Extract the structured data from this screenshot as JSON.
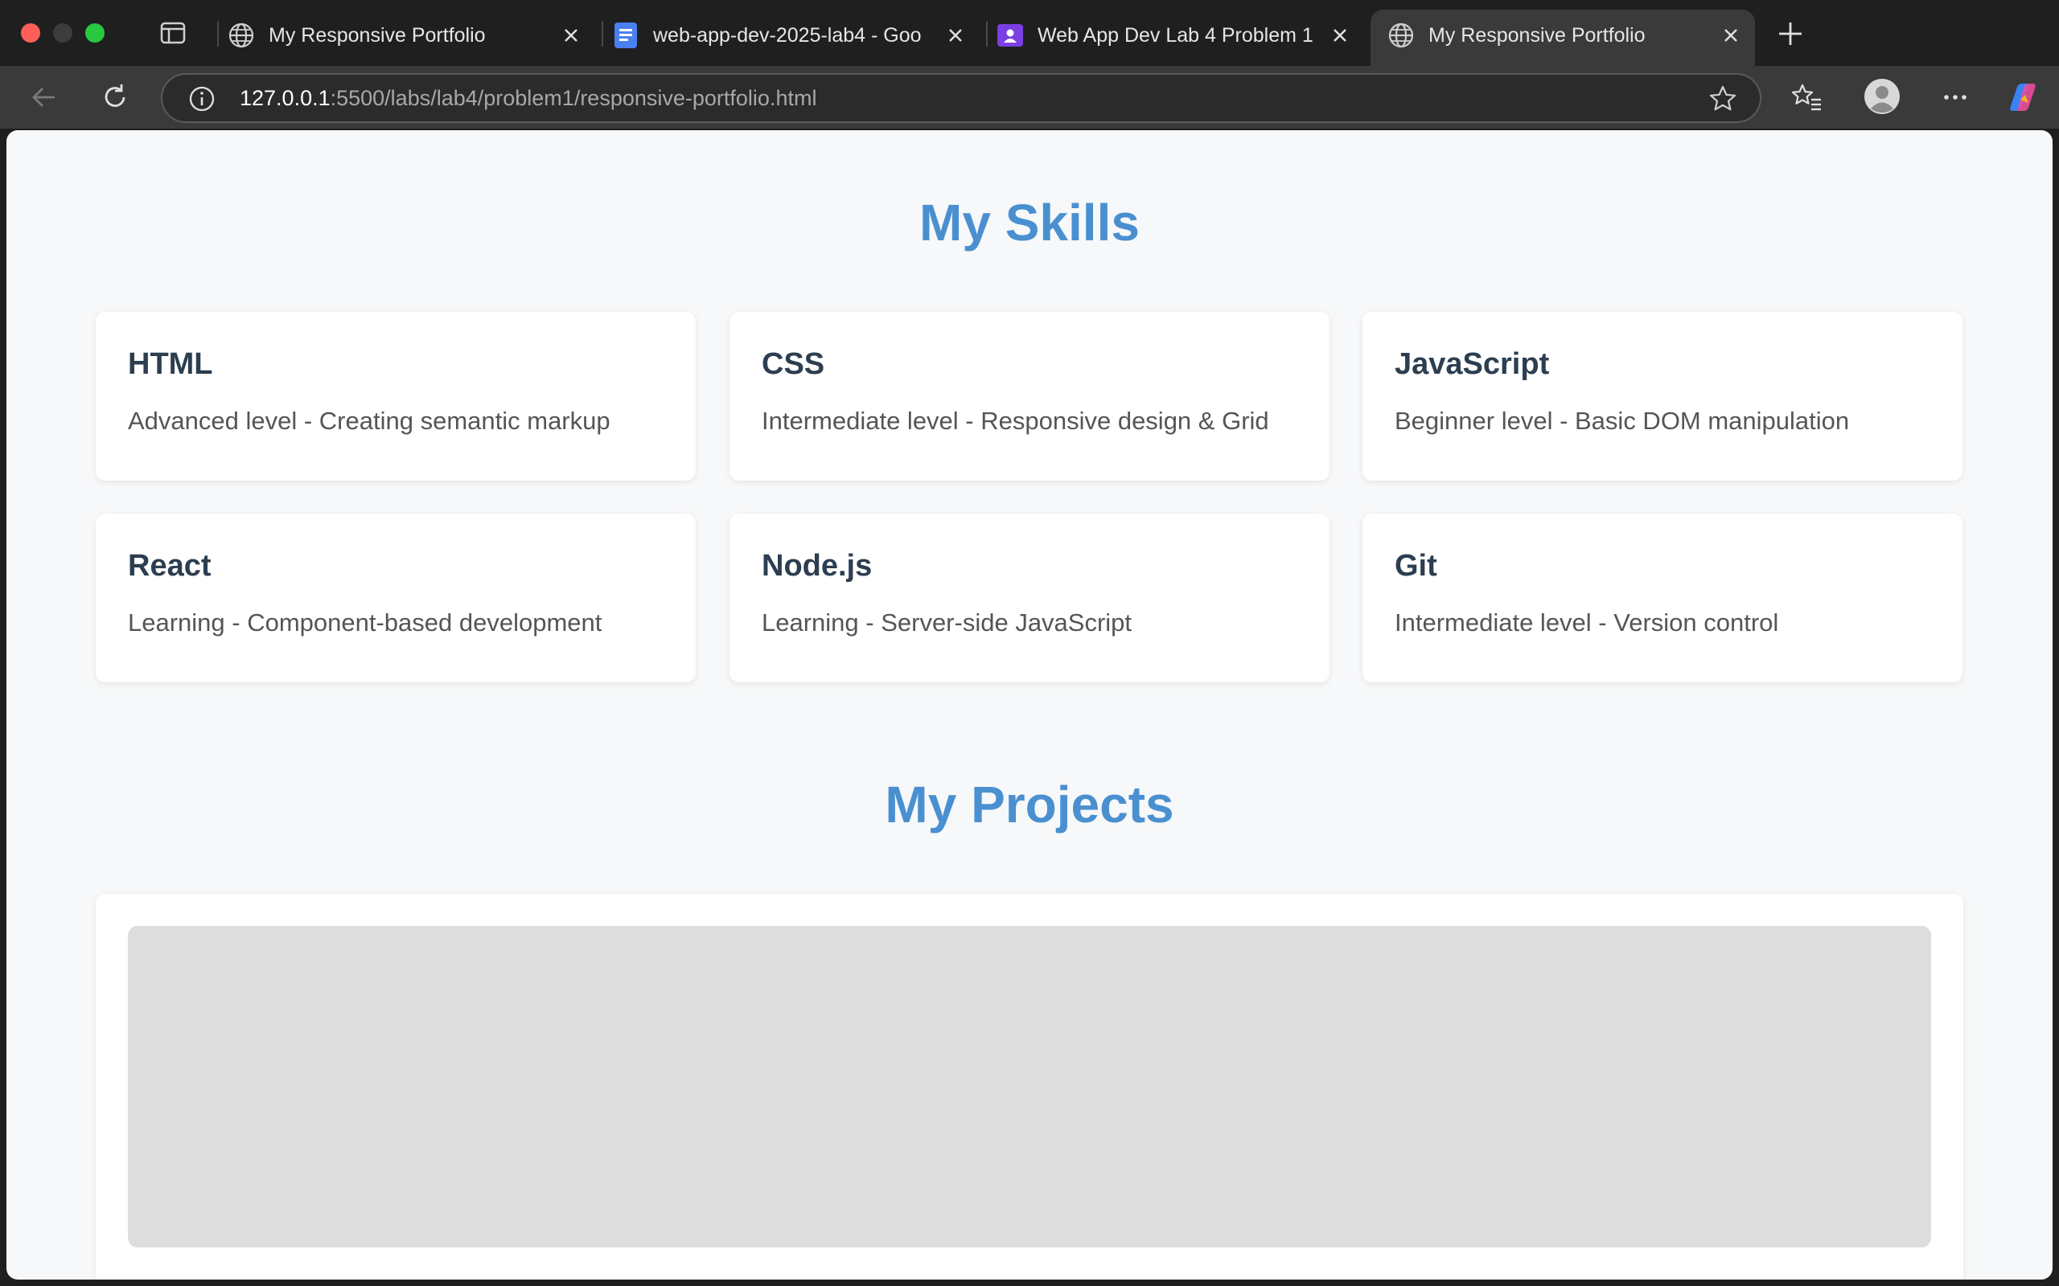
{
  "browser": {
    "tabs": [
      {
        "title": "My Responsive Portfolio",
        "icon": "globe-icon",
        "active": false
      },
      {
        "title": "web-app-dev-2025-lab4 - Goo",
        "icon": "docs-icon",
        "active": false
      },
      {
        "title": "Web App Dev Lab 4 Problem 1",
        "icon": "classroom-icon",
        "active": false
      },
      {
        "title": "My Responsive Portfolio",
        "icon": "globe-icon",
        "active": true
      }
    ],
    "address": {
      "host": "127.0.0.1",
      "path": ":5500/labs/lab4/problem1/responsive-portfolio.html"
    }
  },
  "page": {
    "skills": {
      "title": "My Skills",
      "items": [
        {
          "name": "HTML",
          "description": "Advanced level - Creating semantic markup"
        },
        {
          "name": "CSS",
          "description": "Intermediate level - Responsive design & Grid"
        },
        {
          "name": "JavaScript",
          "description": "Beginner level - Basic DOM manipulation"
        },
        {
          "name": "React",
          "description": "Learning - Component-based development"
        },
        {
          "name": "Node.js",
          "description": "Learning - Server-side JavaScript"
        },
        {
          "name": "Git",
          "description": "Intermediate level - Version control"
        }
      ]
    },
    "projects": {
      "title": "My Projects"
    }
  },
  "colors": {
    "accent": "#4a90d0",
    "card_heading": "#2c3e50",
    "page_background": "#f7f8f9"
  }
}
